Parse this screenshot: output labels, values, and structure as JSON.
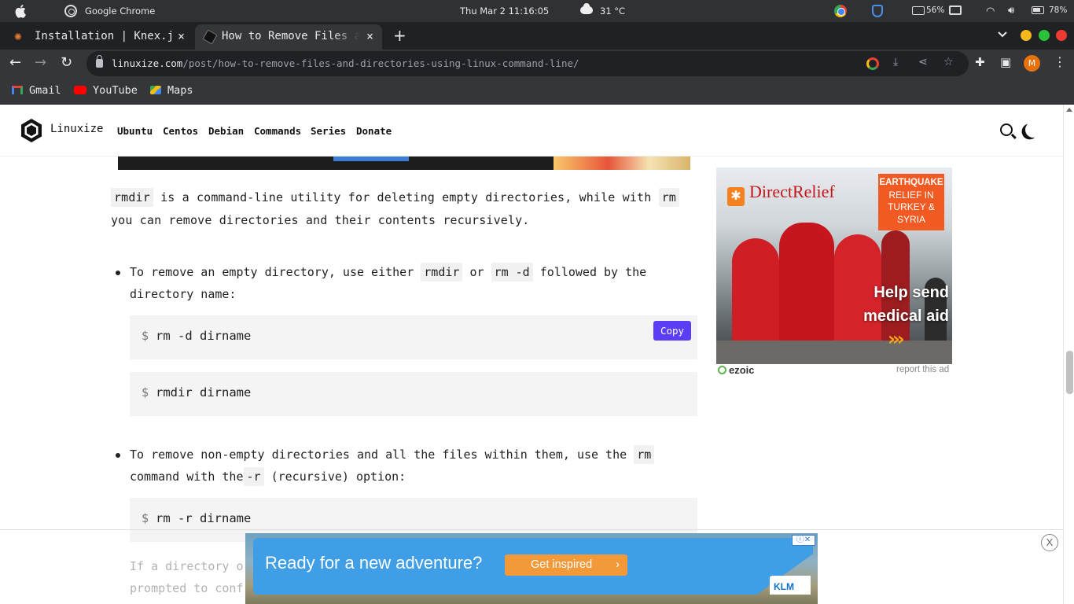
{
  "os_bar": {
    "app_name": "Google Chrome",
    "clock": "Thu Mar 2  11:16:05",
    "temperature": "31 °C",
    "memory": "56%",
    "battery": "78%"
  },
  "browser": {
    "tabs": [
      {
        "title": "Installation | Knex.js",
        "close": "×",
        "active": false
      },
      {
        "title": "How to Remove Files and Directories",
        "close": "×",
        "active": true
      }
    ],
    "new_tab": "+",
    "url_host": "linuxize.com",
    "url_path": "/post/how-to-remove-files-and-directories-using-linux-command-line/",
    "avatar_initial": "M",
    "bookmarks": [
      "Gmail",
      "YouTube",
      "Maps"
    ]
  },
  "site": {
    "logo_text": "Linuxize",
    "nav": [
      "Ubuntu",
      "Centos",
      "Debian",
      "Commands",
      "Series",
      "Donate"
    ]
  },
  "article": {
    "intro": {
      "code1": "rmdir",
      "text1": " is a command-line utility for deleting empty directories, while with ",
      "code2": "rm",
      "text2": "you can remove directories and their contents recursively."
    },
    "bullet1": {
      "text1": "To remove an empty directory, use either ",
      "code1": "rmdir",
      "text2": " or ",
      "code2": "rm -d",
      "text3": " followed by the",
      "text4": "directory name:"
    },
    "code_blocks": [
      {
        "prompt": "$",
        "command": "rm -d dirname"
      },
      {
        "prompt": "$",
        "command": "rmdir dirname"
      },
      {
        "prompt": "$",
        "command": "rm -r dirname"
      }
    ],
    "copy_label": "Copy",
    "bullet2": {
      "text1": "To remove non-empty directories and all the files within them, use the ",
      "code1": "rm",
      "text2": "command with the",
      "code2": "-r",
      "text3": " (recursive) option:"
    },
    "faded_lines": [
      "If a directory o",
      "prompted to conf"
    ]
  },
  "side_ad": {
    "brand": "DirectRelief",
    "badge_title": "EARTHQUAKE",
    "badge_lines": [
      "RELIEF IN",
      "TURKEY &",
      "SYRIA"
    ],
    "headline_1": "Help send",
    "headline_2": "medical aid",
    "arrows": "›››",
    "ezoic": "ezoic",
    "report": "report this ad"
  },
  "bottom_ad": {
    "headline": "Ready for a new adventure?",
    "cta": "Get inspired",
    "cta_arrow": "›",
    "brand": "KLM",
    "close": "X",
    "adchoices": "ⓘ✕"
  },
  "colors": {
    "copy_button": "#5b3df5",
    "cta": "#f29a3a",
    "banner_blue": "#3f9ee6",
    "relief_red": "#c4161c",
    "relief_orange": "#f15a22"
  }
}
